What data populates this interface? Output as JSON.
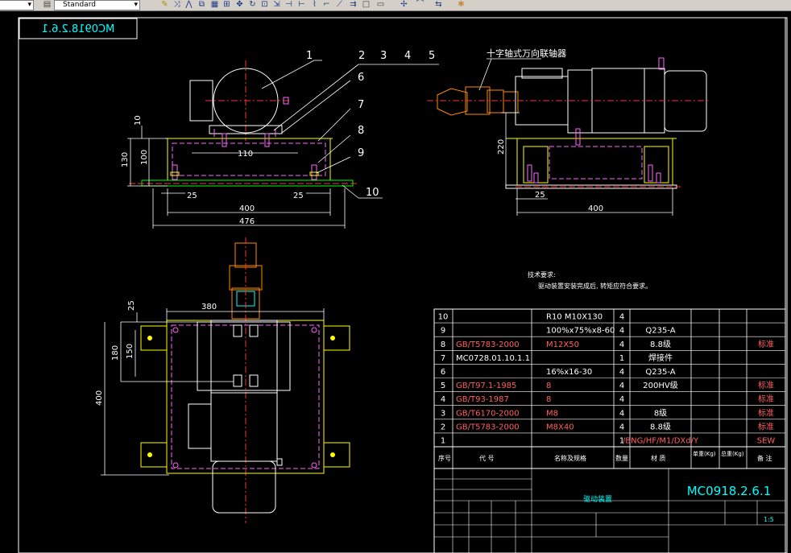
{
  "toolbar": {
    "style_left_value": "",
    "style_value": "Standard",
    "icons": [
      "dropdown-arrow-icon",
      "text-style-icon",
      "pencil-icon",
      "move-icon",
      "mirror-icon",
      "copy-icon",
      "grid-icon",
      "pan-icon",
      "rotate-icon",
      "scale-icon",
      "stretch-icon",
      "trim-icon",
      "extend-icon",
      "break-icon",
      "rect-icon",
      "explode-icon",
      "offset-icon",
      "fillet-icon"
    ]
  },
  "drawing": {
    "title_block_mirrored": "MC0918.2.6.1",
    "callouts": [
      "1",
      "2",
      "3",
      "4",
      "5",
      "6",
      "7",
      "8",
      "9",
      "10"
    ],
    "front_dims": {
      "d10": "10",
      "d130": "130",
      "d100": "100",
      "d110": "110",
      "d25a": "25",
      "d25b": "25",
      "d400": "400",
      "d476": "476"
    },
    "side_label": "十字轴式万向联轴器",
    "side_dims": {
      "d220": "220",
      "d25": "25",
      "d400": "400"
    },
    "plan_dims": {
      "d25": "25",
      "d380": "380",
      "d180": "180",
      "d150": "150",
      "d400": "400"
    },
    "tech_req_title": "技术要求:",
    "tech_req_text": "驱动装置安装完成后, 转矩应符合要求。",
    "drawing_number": "MC0918.2.6.1",
    "scale": "1:5"
  },
  "bom": {
    "rows": [
      {
        "no": "10",
        "code": "",
        "name": "R10 M10X130",
        "qty": "4",
        "material": "",
        "note": ""
      },
      {
        "no": "9",
        "code": "",
        "name": "100%x75%x8-60",
        "qty": "4",
        "material": "Q235-A",
        "note": ""
      },
      {
        "no": "8",
        "code": "GB/T5783-2000",
        "name": "M12X50",
        "qty": "4",
        "material": "8.8级",
        "note": "标准"
      },
      {
        "no": "7",
        "code": "MC0728.01.10.1.1",
        "name": "",
        "qty": "1",
        "material": "焊接件",
        "note": ""
      },
      {
        "no": "6",
        "code": "",
        "name": "16%x16-30",
        "qty": "4",
        "material": "Q235-A",
        "note": ""
      },
      {
        "no": "5",
        "code": "GB/T97.1-1985",
        "name": "8",
        "qty": "4",
        "material": "200HV级",
        "note": "标准"
      },
      {
        "no": "4",
        "code": "GB/T93-1987",
        "name": "8",
        "qty": "4",
        "material": "",
        "note": "标准"
      },
      {
        "no": "3",
        "code": "GB/T6170-2000",
        "name": "M8",
        "qty": "4",
        "material": "8级",
        "note": "标准"
      },
      {
        "no": "2",
        "code": "GB/T5783-2000",
        "name": "M8X40",
        "qty": "4",
        "material": "8.8级",
        "note": "标准"
      },
      {
        "no": "1",
        "code": "",
        "name": "",
        "qty": "1",
        "material": "/BNG/HF/M1/DXd/Y",
        "note": "SEW"
      }
    ],
    "headers": {
      "no": "序号",
      "code": "代 号",
      "name": "名称及规格",
      "qty": "数量",
      "material": "材 质",
      "unit_weight": "单重(Kg)",
      "total_weight": "总重(Kg)",
      "note": "备 注"
    },
    "assembly_name": "驱动装置"
  }
}
